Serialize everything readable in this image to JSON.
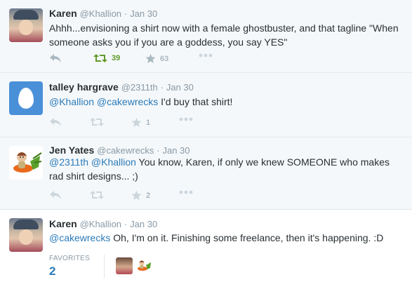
{
  "tweets": [
    {
      "name": "Karen",
      "handle": "@Khallion",
      "sep": "·",
      "date": "Jan 30",
      "text_line1": "Ahhh...envisioning a shirt now with a female ghostbuster, and that tagline \"When",
      "text_line2": "someone asks you if you are a goddess, you say YES\"",
      "retweets": "39",
      "favorites": "63"
    },
    {
      "name": "talley hargrave",
      "handle": "@2311th",
      "sep": "·",
      "date": "Jan 30",
      "mention1": "@Khallion",
      "mention2": "@cakewrecks",
      "text": " I'd buy that shirt!",
      "favorites": "1"
    },
    {
      "name": "Jen Yates",
      "handle": "@cakewrecks",
      "sep": "·",
      "date": "Jan 30",
      "mention1": "@2311th",
      "mention2": "@Khallion",
      "text_line1": " You know, Karen, if only we knew SOMEONE who makes",
      "text_line2": "rad shirt designs... ;)",
      "favorites": "2"
    },
    {
      "name": "Karen",
      "handle": "@Khallion",
      "sep": "·",
      "date": "Jan 30",
      "mention1": "@cakewrecks",
      "text": " Oh, I'm on it. Finishing some freelance, then it's happening. :D",
      "favorites_label": "FAVORITES",
      "favorites_count": "2"
    }
  ],
  "colors": {
    "link": "#2b7bb9",
    "retweet_active": "#609928",
    "meta": "#8899a6",
    "icon": "#aab8c2"
  }
}
